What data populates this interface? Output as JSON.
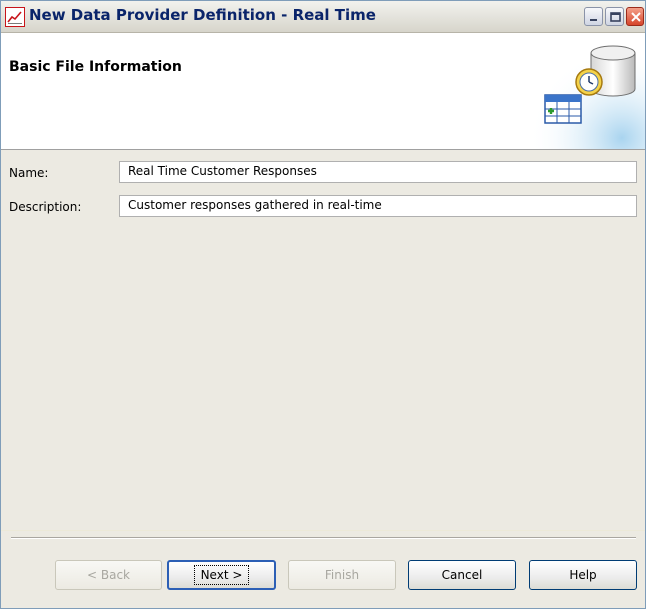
{
  "window": {
    "title": "New Data Provider Definition - Real Time",
    "controls": {
      "minimize_icon": "minimize-icon",
      "maximize_icon": "maximize-icon",
      "close_icon": "close-icon"
    }
  },
  "header": {
    "title": "Basic File Information",
    "graphic_icon": "database-clock-table-icon"
  },
  "form": {
    "name_label": "Name:",
    "name_value": "Real Time Customer Responses",
    "description_label": "Description:",
    "description_value": "Customer responses gathered in real-time"
  },
  "buttons": {
    "back": "< Back",
    "next": "Next >",
    "finish": "Finish",
    "cancel": "Cancel",
    "help": "Help"
  },
  "colors": {
    "title_text": "#0a246a",
    "panel_bg": "#eceae2",
    "accent_blue": "#2c5fb5"
  }
}
